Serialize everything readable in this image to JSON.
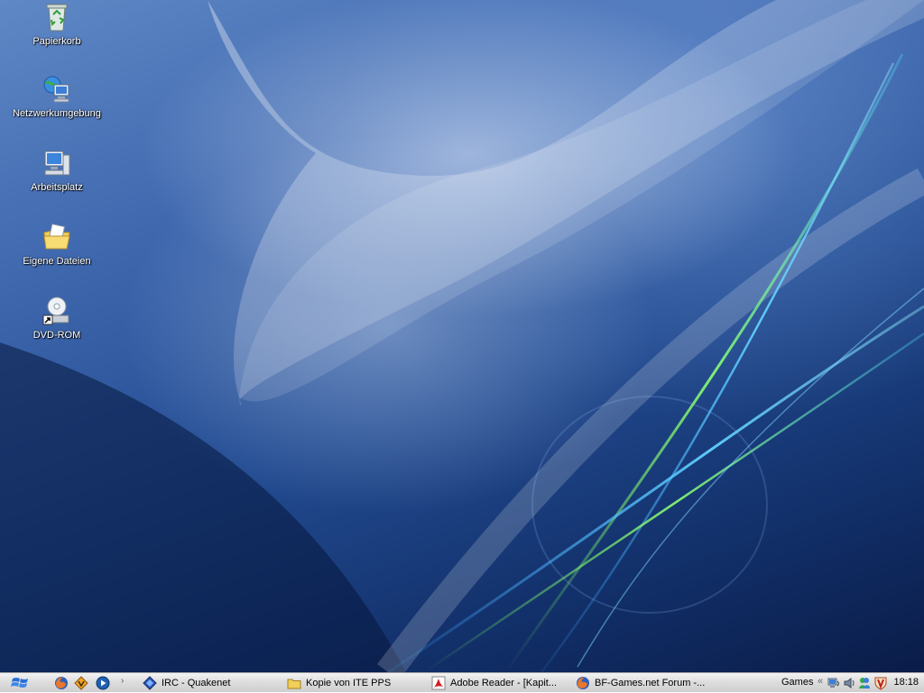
{
  "desktop": {
    "icons": [
      {
        "label": "Papierkorb",
        "icon": "recycle-bin-icon"
      },
      {
        "label": "Netzwerkumgebung",
        "icon": "network-places-icon"
      },
      {
        "label": "Arbeitsplatz",
        "icon": "my-computer-icon"
      },
      {
        "label": "Eigene Dateien",
        "icon": "my-documents-icon"
      },
      {
        "label": "DVD-ROM",
        "icon": "dvd-rom-shortcut-icon"
      }
    ]
  },
  "taskbar": {
    "quick_launch": [
      "firefox-icon",
      "winamp-icon",
      "media-player-icon"
    ],
    "tasks": [
      {
        "label": "IRC - Quakenet",
        "icon": "irc-client-icon"
      },
      {
        "label": "Kopie von ITE PPS",
        "icon": "folder-icon"
      },
      {
        "label": "Adobe Reader - [Kapit...",
        "icon": "adobe-reader-icon"
      },
      {
        "label": "BF-Games.net Forum -...",
        "icon": "firefox-icon"
      }
    ],
    "tray": {
      "toolbar_label": "Games",
      "clock": "18:18"
    }
  },
  "colors": {
    "taskbar_bg": "#dcdcdc",
    "desktop_top": "#5f88c6",
    "desktop_bottom": "#0a1c48"
  }
}
